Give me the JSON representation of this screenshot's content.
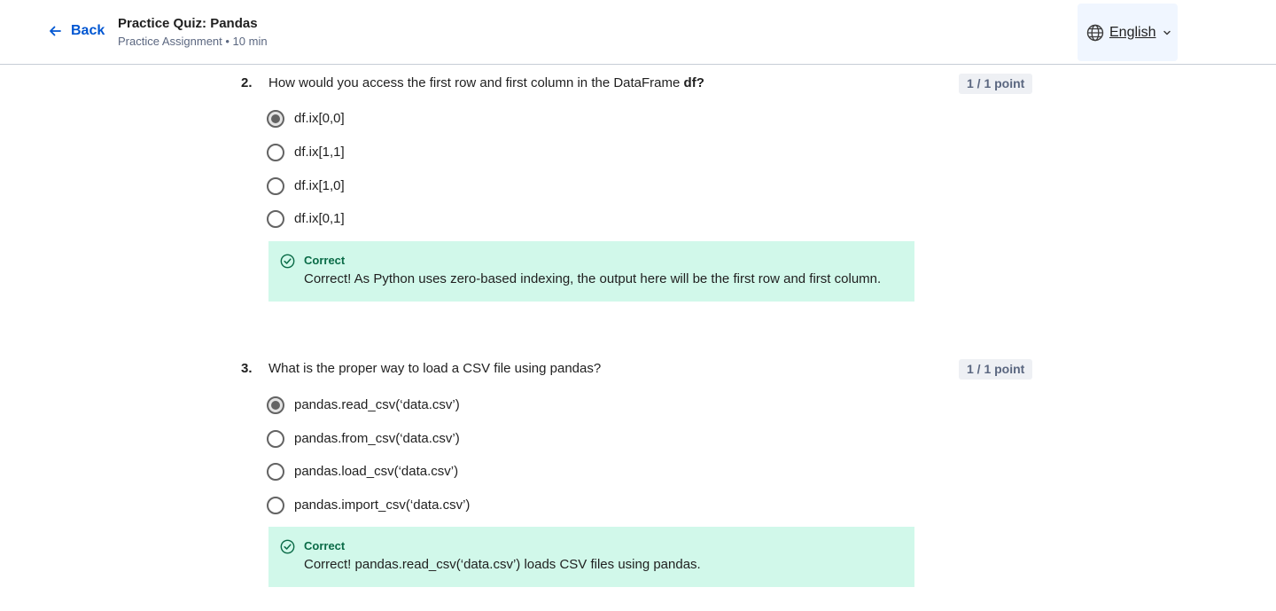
{
  "header": {
    "back_label": "Back",
    "quiz_title": "Practice Quiz: Pandas",
    "quiz_subtitle": "Practice Assignment • 10 min",
    "language_label": "English",
    "icons": {
      "back": "arrow-left-icon",
      "language": "globe-icon",
      "dropdown": "chevron-down-icon"
    },
    "accent_color": "#0056d2"
  },
  "questions": [
    {
      "number": "2.",
      "text_before": "How would you access the first row and first column in the DataFrame ",
      "text_bold": "df?",
      "points": "1 / 1 point",
      "options": [
        "df.ix[0,0]",
        "df.ix[1,1]",
        "df.ix[1,0]",
        "df.ix[0,1]"
      ],
      "selected_index": 0,
      "feedback": {
        "title": "Correct",
        "text": "Correct! As Python uses zero-based indexing, the output here will be the first row and first column.",
        "icon": "check-circle-icon",
        "color": "#d1f8ea"
      }
    },
    {
      "number": "3.",
      "text_before": "What is the proper way to load a CSV file using pandas?",
      "text_bold": "",
      "points": "1 / 1 point",
      "options": [
        "pandas.read_csv(‘data.csv’)",
        "pandas.from_csv(‘data.csv’)",
        "pandas.load_csv(‘data.csv’)",
        "pandas.import_csv(‘data.csv’)"
      ],
      "selected_index": 0,
      "feedback": {
        "title": "Correct",
        "text": "Correct! pandas.read_csv(‘data.csv’) loads CSV files using pandas.",
        "icon": "check-circle-icon",
        "color": "#d1f8ea"
      }
    }
  ]
}
